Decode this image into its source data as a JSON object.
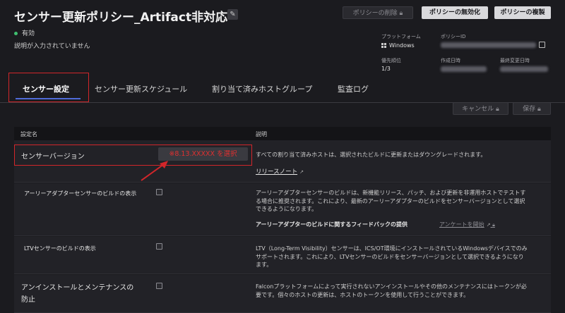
{
  "header": {
    "title": "センサー更新ポリシー_Artifact非対応",
    "status": "有効",
    "description": "説明が入力されていません",
    "delete_label": "ポリシーの削除",
    "disable_label": "ポリシーの無効化",
    "duplicate_label": "ポリシーの複製"
  },
  "meta": {
    "platform_label": "プラットフォーム",
    "platform_value": "Windows",
    "policy_id_label": "ポリシーID",
    "priority_label": "優先順位",
    "priority_value": "1/3",
    "created_label": "作成日時",
    "modified_label": "最終変更日時"
  },
  "tabs": [
    {
      "label": "センサー設定"
    },
    {
      "label": "センサー更新スケジュール"
    },
    {
      "label": "割り当て済みホストグループ"
    },
    {
      "label": "監査ログ"
    }
  ],
  "toolbar": {
    "cancel_label": "キャンセル",
    "save_label": "保存"
  },
  "table": {
    "col_name": "設定名",
    "col_desc": "説明",
    "rows": [
      {
        "name": "センサーバージョン",
        "value": "※8.13.XXXXX を選択",
        "desc": "すべての割り当て済みホストは、選択されたビルドに更新またはダウングレードされます。",
        "link": "リリースノート"
      },
      {
        "name": "アーリーアダプターセンサーのビルドの表示",
        "desc": "アーリーアダプターセンサーのビルドは、新機能リリース、パッチ、および更新を非運用ホストでテストする場合に推奨されます。これにより、最新のアーリーアダプターのビルドをセンサーバージョンとして選択できるようになります。",
        "feedback_label": "アーリーアダプターのビルドに関するフィードバックの提供",
        "feedback_link": "アンケートを開始"
      },
      {
        "name": "LTVセンサーのビルドの表示",
        "desc": "LTV（Long-Term Visibility）センサーは、ICS/OT環境にインストールされているWindowsデバイスでのみサポートされます。これにより、LTVセンサーのビルドをセンサーバージョンとして選択できるようになります。"
      },
      {
        "name_line1": "アンインストールとメンテナンスの",
        "name_line2": "防止",
        "desc": "Falconプラットフォームによって実行されないアンインストールやその他のメンテナンスにはトークンが必要です。個々のホストの更新は、ホストのトークンを使用して行うことができます。"
      }
    ]
  },
  "colors": {
    "accent": "#4f6bd8",
    "annotation_red": "#d2262a",
    "status_green": "#3fbf6f"
  }
}
